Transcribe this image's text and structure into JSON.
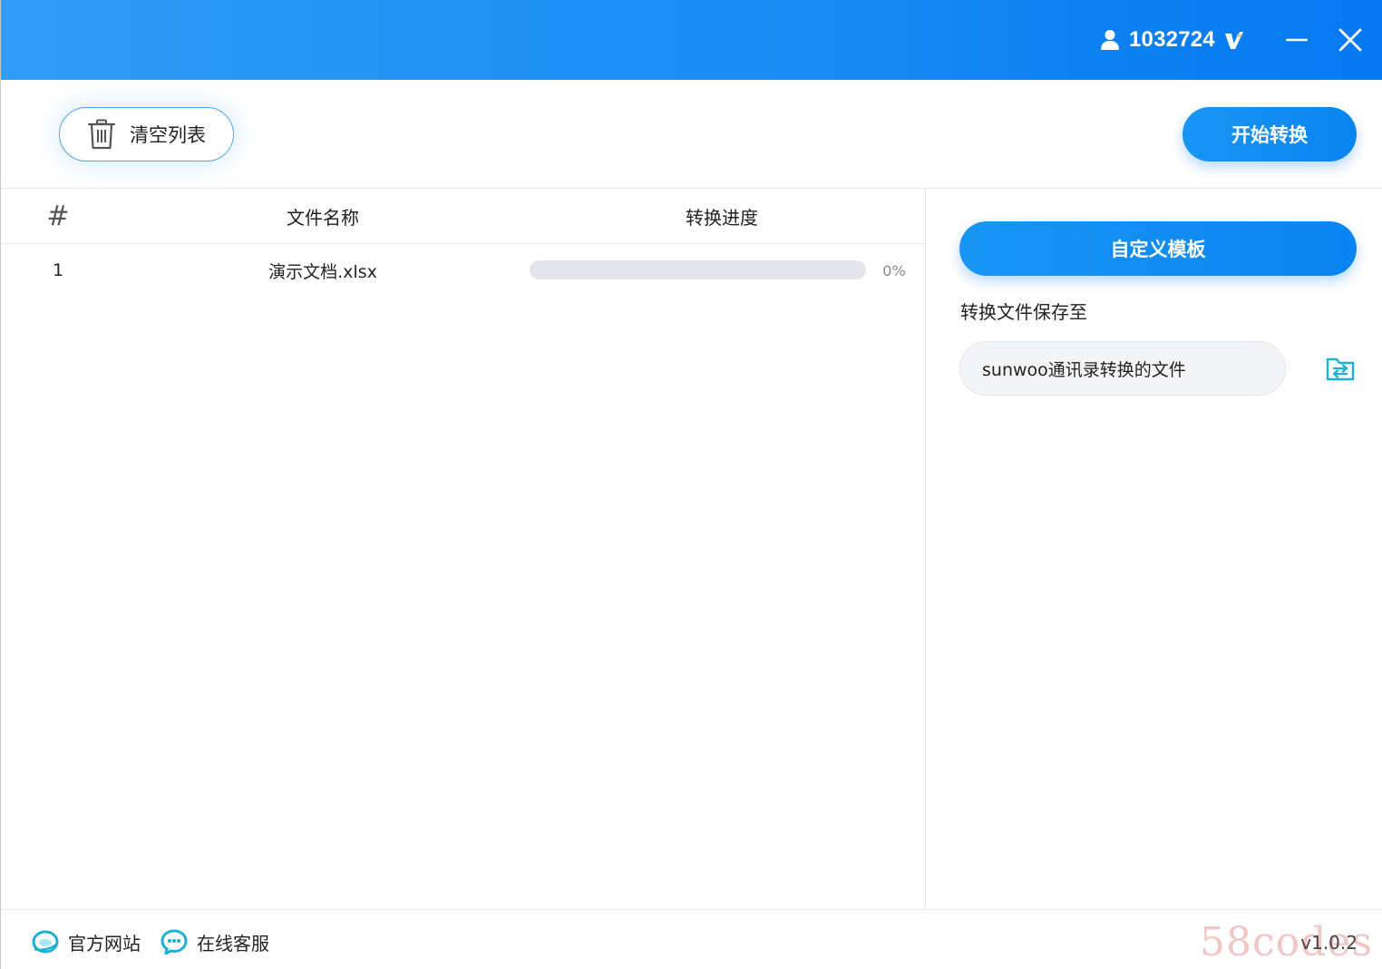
{
  "titlebar": {
    "user_id": "1032724",
    "icons": {
      "user": "user-icon",
      "vip": "vip-badge-icon",
      "minimize": "minimize-icon",
      "close": "close-icon"
    }
  },
  "toolbar": {
    "clear_label": "清空列表",
    "start_label": "开始转换"
  },
  "file_list": {
    "headers": {
      "num": "#",
      "name": "文件名称",
      "progress": "转换进度"
    },
    "rows": [
      {
        "num": "1",
        "name": "演示文档.xlsx",
        "progress_value": 0,
        "progress_text": "0%"
      }
    ]
  },
  "side_panel": {
    "template_label": "自定义模板",
    "save_label": "转换文件保存至",
    "save_path": "sunwoo通讯录转换的文件"
  },
  "footer": {
    "site_label": "官方网站",
    "service_label": "在线客服",
    "version": "v1.0.2",
    "watermark": "58codes"
  },
  "colors": {
    "accent": "#1a8df3",
    "titlebar_start": "#2f9cf5",
    "titlebar_end": "#0478f0",
    "track": "#e4e5ea"
  }
}
